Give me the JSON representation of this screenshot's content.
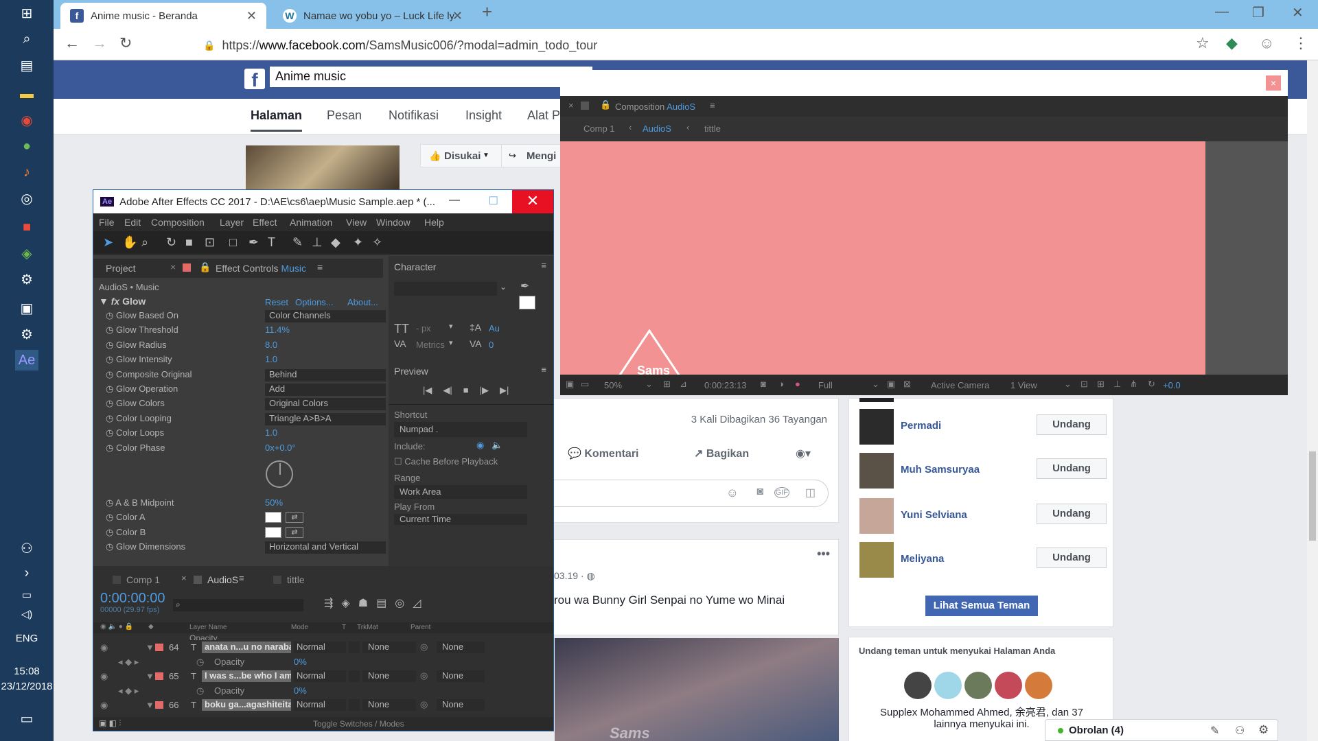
{
  "taskbar": {
    "lang": "ENG",
    "time": "15:08",
    "date": "23/12/2018"
  },
  "browser": {
    "tabs": [
      {
        "title": "Anime music - Beranda"
      },
      {
        "title": "Namae wo yobu yo – Luck Life ly"
      }
    ],
    "url_prefix": "https://",
    "url_domain": "www.facebook.com",
    "url_path": "/SamsMusic006/?modal=admin_todo_tour"
  },
  "facebook": {
    "search_value": "Anime music",
    "nav": [
      "Halaman",
      "Pesan",
      "Notifikasi",
      "Insight",
      "Alat P"
    ],
    "liked_label": "Disukai",
    "follow_label": "Mengi",
    "post_stats": "3 Kali Dibagikan  36 Tayangan",
    "actions": {
      "comment": "Komentari",
      "share": "Bagikan"
    },
    "post2_date": "03.19 ·",
    "post2_text": "rou wa Bunny Girl Senpai no Yume wo Minai",
    "friends": [
      {
        "name": "Permadi",
        "action": "Undang"
      },
      {
        "name": "Muh Samsuryaa",
        "action": "Undang"
      },
      {
        "name": "Yuni Selviana",
        "action": "Undang"
      },
      {
        "name": "Meliyana",
        "action": "Undang"
      }
    ],
    "see_all": "Lihat Semua Teman",
    "invite_title": "Undang teman untuk menyukai Halaman Anda",
    "invite_text_1": "Supplex Mohammed Ahmed, 余亮君, dan 37",
    "invite_text_2": "lainnya menyukai ini.",
    "chat": "Obrolan (4)"
  },
  "ae": {
    "title": "Adobe After Effects CC 2017 - D:\\AE\\cs6\\aep\\Music Sample.aep * (...",
    "menu": [
      "File",
      "Edit",
      "Composition",
      "Layer",
      "Effect",
      "Animation",
      "View",
      "Window",
      "Help"
    ],
    "project_tab": "Project",
    "effect_tab": "Effect Controls",
    "effect_tab_layer": "Music",
    "breadcrumb": "AudioS • Music",
    "effect_name": "Glow",
    "effect_links": [
      "Reset",
      "Options...",
      "About..."
    ],
    "props": [
      {
        "name": "Glow Based On",
        "value": "Color Channels",
        "type": "drop"
      },
      {
        "name": "Glow Threshold",
        "value": "11.4%",
        "type": "num"
      },
      {
        "name": "Glow Radius",
        "value": "8.0",
        "type": "num"
      },
      {
        "name": "Glow Intensity",
        "value": "1.0",
        "type": "num"
      },
      {
        "name": "Composite Original",
        "value": "Behind",
        "type": "drop"
      },
      {
        "name": "Glow Operation",
        "value": "Add",
        "type": "drop"
      },
      {
        "name": "Glow Colors",
        "value": "Original Colors",
        "type": "drop"
      },
      {
        "name": "Color Looping",
        "value": "Triangle A>B>A",
        "type": "drop"
      },
      {
        "name": "Color Loops",
        "value": "1.0",
        "type": "num"
      },
      {
        "name": "Color Phase",
        "value": "0x+0.0°",
        "type": "num"
      }
    ],
    "props2": [
      {
        "name": "A & B Midpoint",
        "value": "50%",
        "type": "num"
      },
      {
        "name": "Color A",
        "value": "",
        "type": "swatch"
      },
      {
        "name": "Color B",
        "value": "",
        "type": "swatch"
      },
      {
        "name": "Glow Dimensions",
        "value": "Horizontal and Vertical",
        "type": "drop"
      }
    ],
    "character": "Character",
    "char_px": "- px",
    "char_metrics": "Metrics",
    "char_au": "Au",
    "char_zero": "0",
    "preview": "Preview",
    "shortcut_label": "Shortcut",
    "shortcut_value": "Numpad .",
    "include": "Include:",
    "cache": "Cache Before Playback",
    "range": "Range",
    "range_value": "Work Area",
    "play_from": "Play From",
    "current_time": "Current Time",
    "timeline_tabs": [
      "Comp 1",
      "AudioS",
      "tittle"
    ],
    "timecode": "0:00:00:00",
    "timecode_sub": "00000 (29.97 fps)",
    "col_headers": {
      "layer": "Layer Name",
      "mode": "Mode",
      "t": "T",
      "trkmat": "TrkMat",
      "parent": "Parent"
    },
    "layers": [
      {
        "num": "64",
        "name": "anata n...u no naraba",
        "mode": "Normal",
        "trk": "None",
        "parent": "None",
        "opacity": "0%"
      },
      {
        "num": "65",
        "name": "I was s...be who I am",
        "mode": "Normal",
        "trk": "None",
        "parent": "None",
        "opacity": "0%"
      },
      {
        "num": "66",
        "name": "boku ga...agashiteita",
        "mode": "Normal",
        "trk": "None",
        "parent": "None"
      }
    ],
    "opacity_label": "Opacity",
    "top_opacity": "0%",
    "toggle": "Toggle Switches / Modes"
  },
  "comp": {
    "title_prefix": "Composition",
    "title_name": "AudioS",
    "crumbs": [
      "Comp 1",
      "AudioS",
      "tittle"
    ],
    "zoom": "50%",
    "time": "0:00:23:13",
    "quality": "Full",
    "camera": "Active Camera",
    "view": "1 View",
    "exposure": "+0.0",
    "canvas_text": "Sams"
  },
  "colors": {
    "fb_blue": "#3b5998",
    "ae_blue": "#4e9be0",
    "canvas": "#f39292"
  }
}
